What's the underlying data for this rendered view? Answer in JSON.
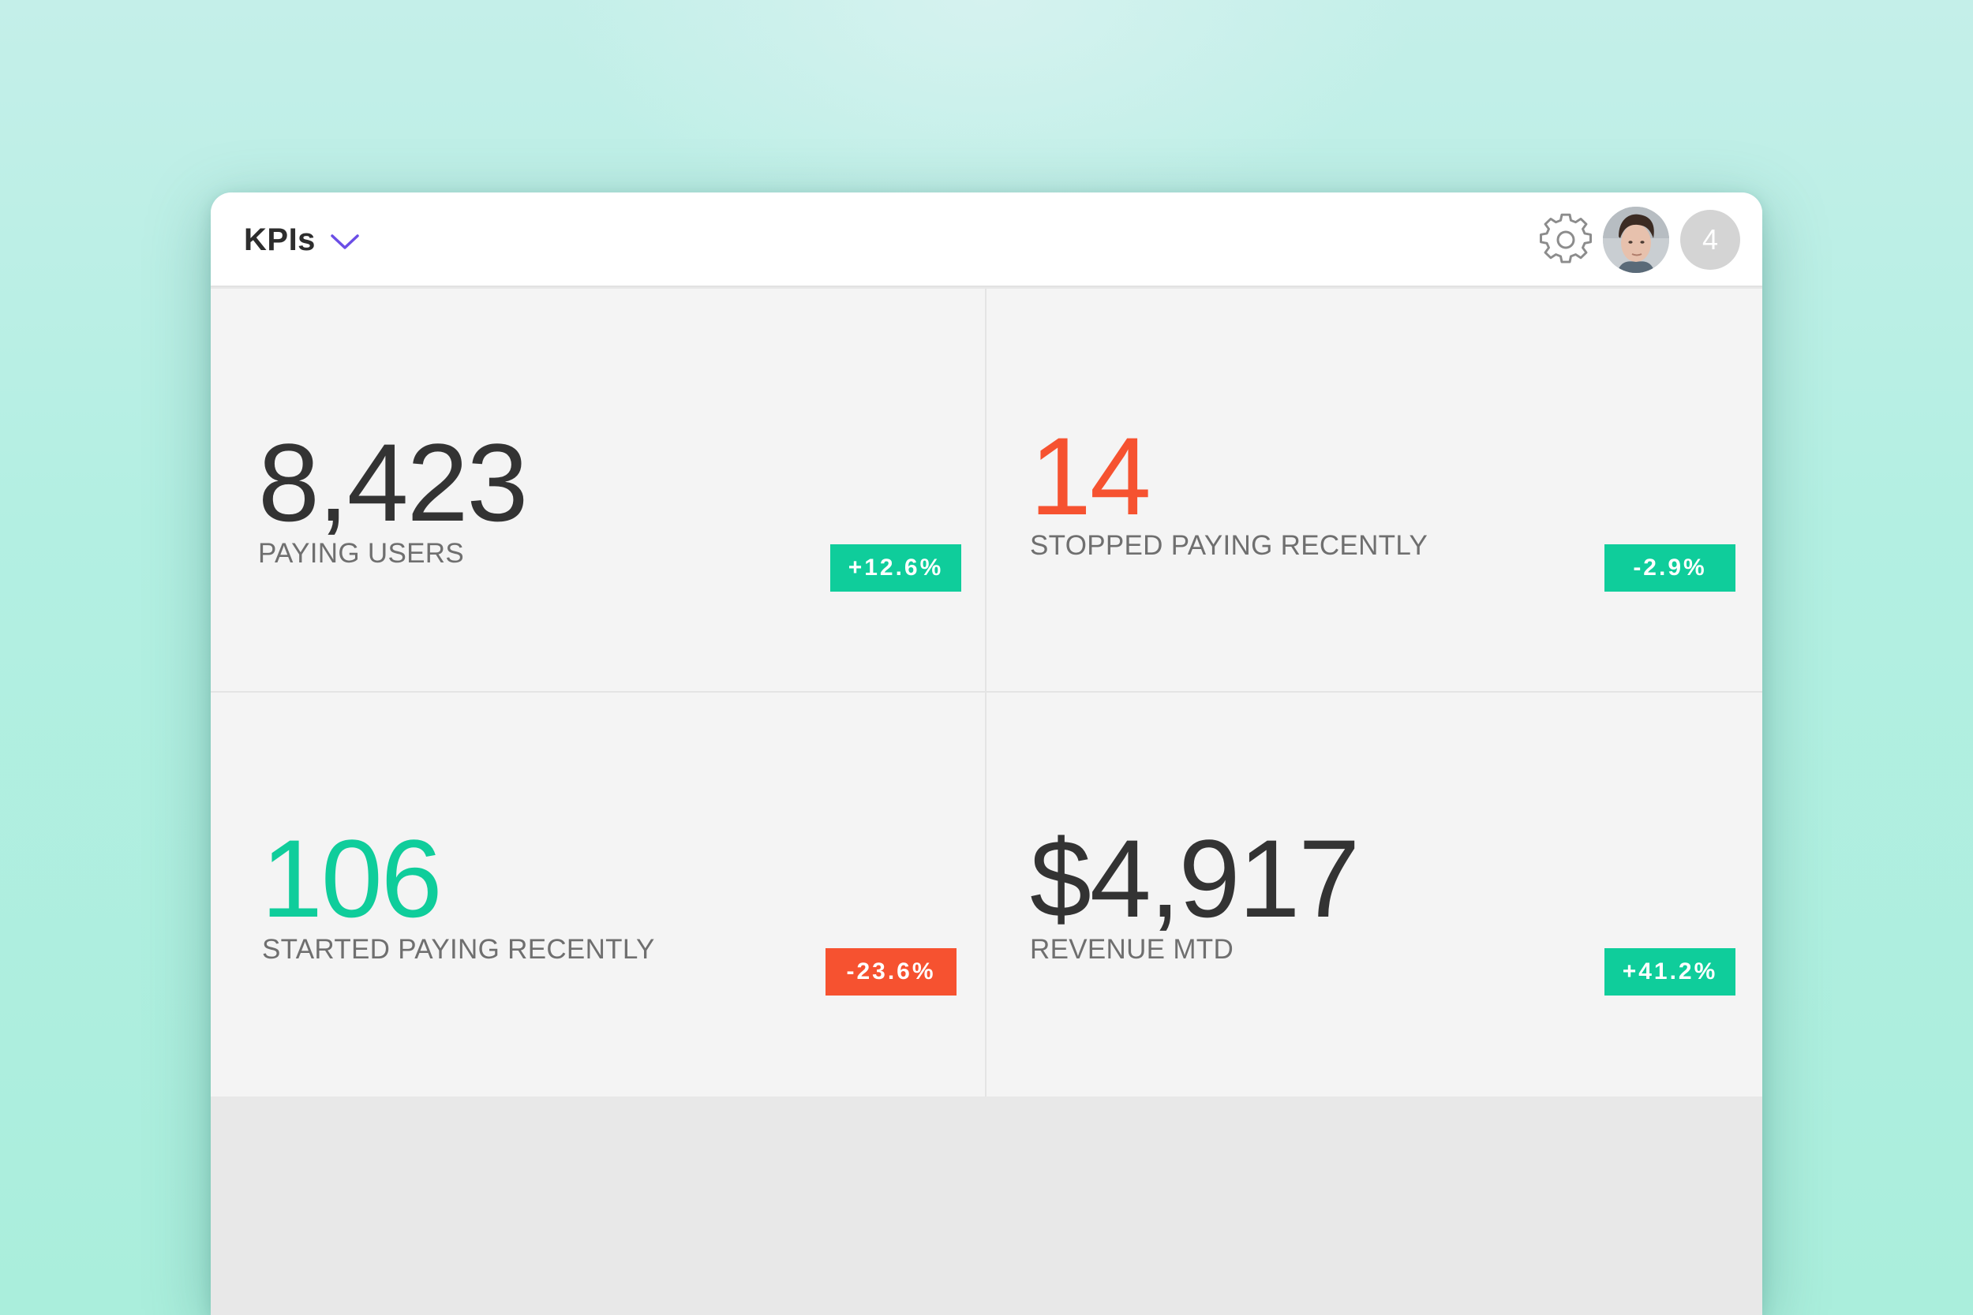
{
  "header": {
    "title": "KPIs",
    "notification_count": "4"
  },
  "icons": {
    "dropdown": "chevron-down-icon",
    "settings": "gear-icon",
    "avatar": "user-avatar"
  },
  "colors": {
    "accent": "#6b4ee6",
    "positive": "#0fcd9b",
    "negative": "#f65230",
    "text": "#333333"
  },
  "kpis": [
    {
      "value": "8,423",
      "label": "PAYING USERS",
      "change": "+12.6%",
      "value_tone": "default",
      "change_tone": "positive"
    },
    {
      "value": "14",
      "label": "STOPPED PAYING RECENTLY",
      "change": "-2.9%",
      "value_tone": "negative",
      "change_tone": "positive"
    },
    {
      "value": "106",
      "label": "STARTED PAYING RECENTLY",
      "change": "-23.6%",
      "value_tone": "positive",
      "change_tone": "negative"
    },
    {
      "value": "$4,917",
      "label": "REVENUE MTD",
      "change": "+41.2%",
      "value_tone": "default",
      "change_tone": "positive"
    }
  ]
}
